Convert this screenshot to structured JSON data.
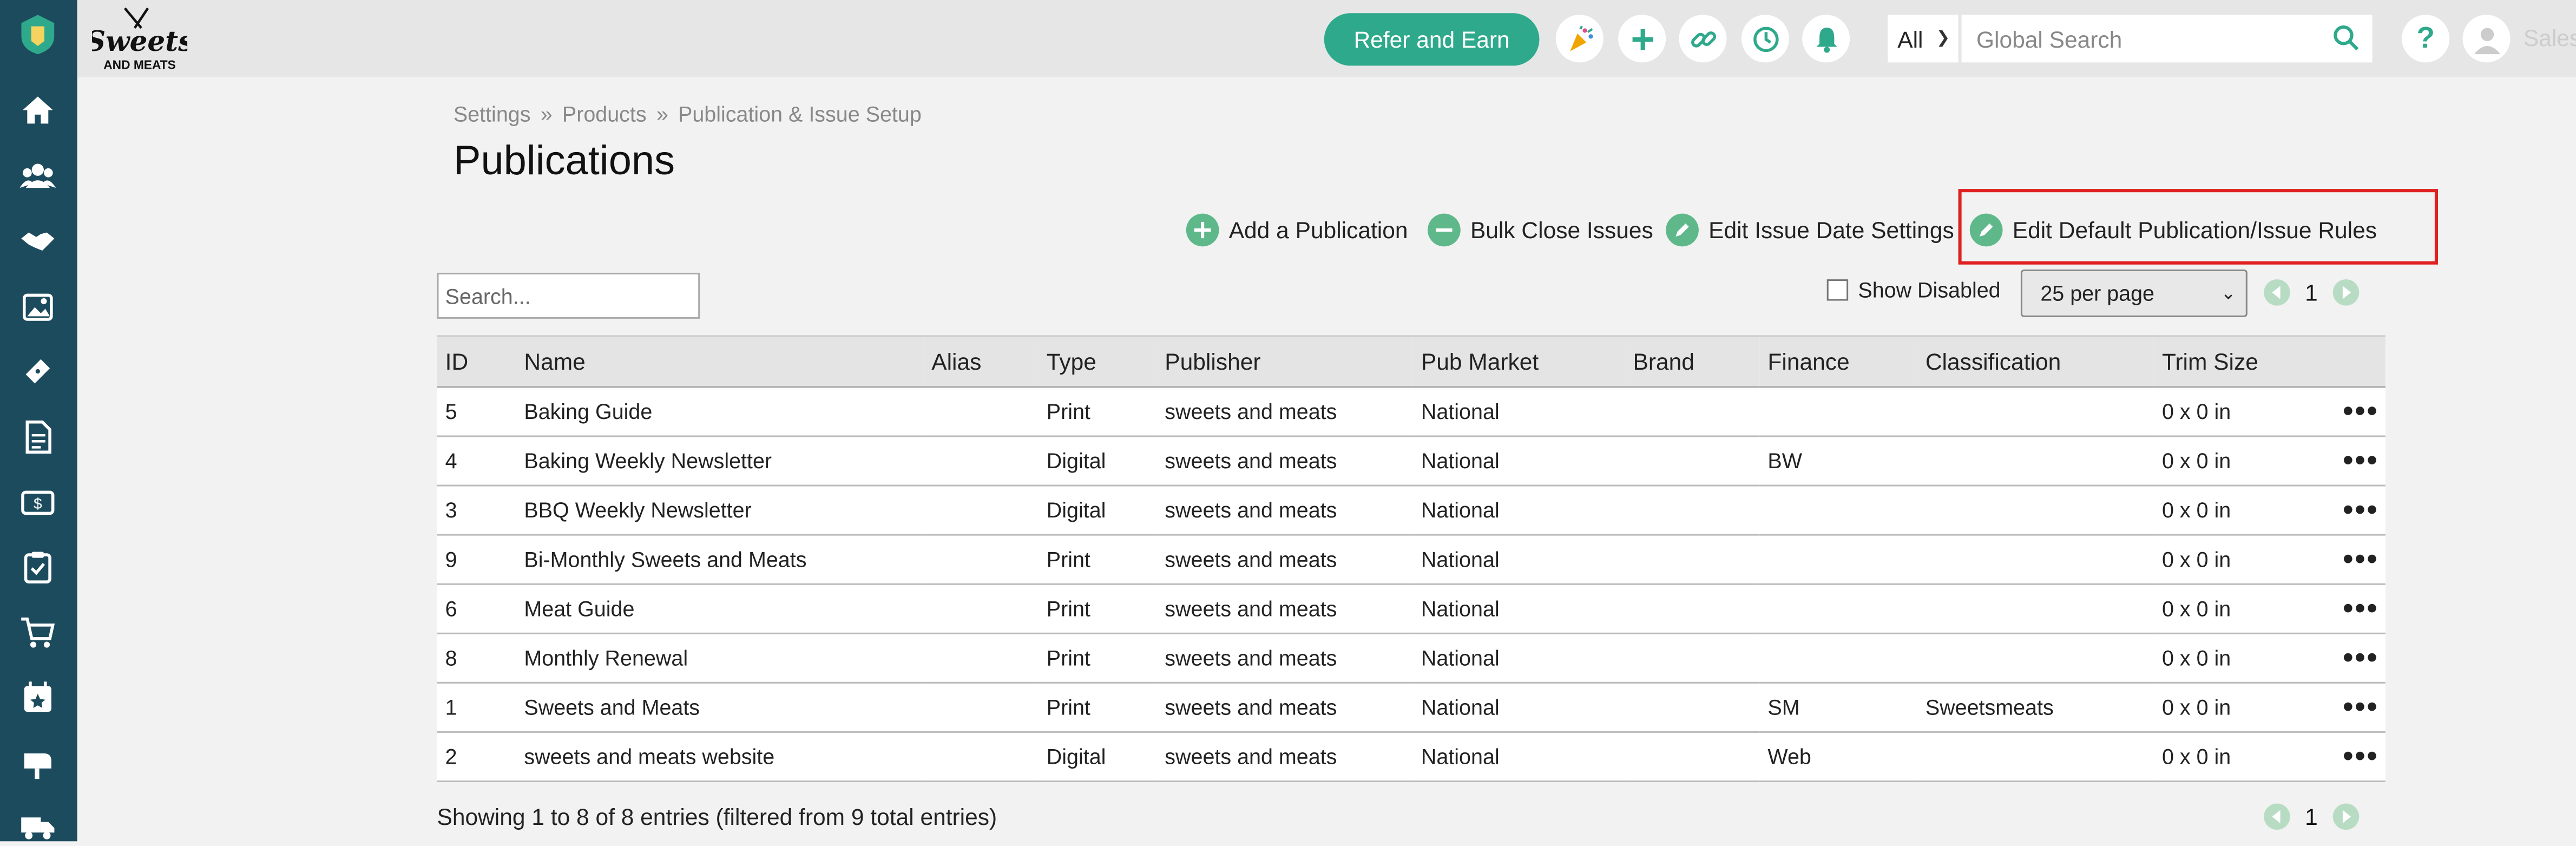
{
  "header": {
    "brand_top": "Sweets",
    "brand_bottom": "AND MEATS",
    "refer_label": "Refer and Earn",
    "scope_value": "All",
    "search_placeholder": "Global Search",
    "help_label": "?",
    "user_label": "Sales"
  },
  "breadcrumb": [
    "Settings",
    "Products",
    "Publication & Issue Setup"
  ],
  "breadcrumb_sep": "»",
  "page_title": "Publications",
  "actions": {
    "add": "Add a Publication",
    "bulk_close": "Bulk Close Issues",
    "edit_issue_date": "Edit Issue Date Settings",
    "edit_default": "Edit Default Publication/Issue Rules"
  },
  "filters": {
    "search_placeholder": "Search...",
    "show_disabled": "Show Disabled",
    "per_page": "25 per page",
    "page": "1"
  },
  "table": {
    "columns": [
      "ID",
      "Name",
      "Alias",
      "Type",
      "Publisher",
      "Pub Market",
      "Brand",
      "Finance",
      "Classification",
      "Trim Size",
      ""
    ],
    "rows": [
      [
        "5",
        "Baking Guide",
        "",
        "Print",
        "sweets and meats",
        "National",
        "",
        "",
        "",
        "0 x 0 in"
      ],
      [
        "4",
        "Baking Weekly Newsletter",
        "",
        "Digital",
        "sweets and meats",
        "National",
        "",
        "BW",
        "",
        "0 x 0 in"
      ],
      [
        "3",
        "BBQ Weekly Newsletter",
        "",
        "Digital",
        "sweets and meats",
        "National",
        "",
        "",
        "",
        "0 x 0 in"
      ],
      [
        "9",
        "Bi-Monthly Sweets and Meats",
        "",
        "Print",
        "sweets and meats",
        "National",
        "",
        "",
        "",
        "0 x 0 in"
      ],
      [
        "6",
        "Meat Guide",
        "",
        "Print",
        "sweets and meats",
        "National",
        "",
        "",
        "",
        "0 x 0 in"
      ],
      [
        "8",
        "Monthly Renewal",
        "",
        "Print",
        "sweets and meats",
        "National",
        "",
        "",
        "",
        "0 x 0 in"
      ],
      [
        "1",
        "Sweets and Meats",
        "",
        "Print",
        "sweets and meats",
        "National",
        "",
        "SM",
        "Sweetsmeats",
        "0 x 0 in"
      ],
      [
        "2",
        "sweets and meats website",
        "",
        "Digital",
        "sweets and meats",
        "National",
        "",
        "Web",
        "",
        "0 x 0 in"
      ]
    ],
    "row_menu": "•••"
  },
  "footer": {
    "info": "Showing 1 to 8 of 8 entries (filtered from 9 total entries)",
    "page": "1"
  },
  "colors": {
    "sidebar": "#1d4b5e",
    "accent": "#2fa98b",
    "highlight": "#e02020"
  }
}
